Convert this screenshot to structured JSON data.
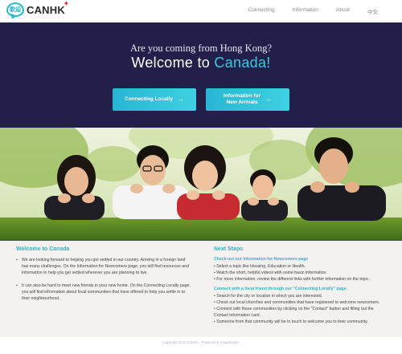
{
  "brand": {
    "logo_glyph": "歡迎",
    "name": "CANHK",
    "star": "✦"
  },
  "nav": {
    "items": [
      "Connecting",
      "Information",
      "About",
      "中文"
    ]
  },
  "hero": {
    "subtitle": "Are you coming from Hong Kong?",
    "title_prefix": "Welcome to ",
    "title_accent": "Canada!",
    "buttons": [
      {
        "label": "Connecting Locally",
        "arrow": "→"
      },
      {
        "label_line1": "Information for",
        "label_line2": "New Arrivals",
        "arrow": "→"
      }
    ]
  },
  "photo": {
    "icon": "family-photo"
  },
  "welcome": {
    "title": "Welcome to Canada",
    "paragraphs": [
      "We are looking forward to helping you get settled in our country.  Arriving in a foreign land has many challenges.  On the Information for Newcomers page, you will find resources and information to help you get settled wherever you are planning to live.",
      "It can also be hard to meet new friends in your new home. On the Connecting Locally page, you will find information about local communities that have offered to help you settle in to their neighbourhood."
    ]
  },
  "next_steps": {
    "title": "Next Steps",
    "groups": [
      {
        "heading": "Check out our Information for Newcomers page",
        "lines": [
          "• Select a topic like Housing, Education or Health.",
          "• Watch the short, helpful videos with some basic information.",
          "• For more information, review the different links with further information on the topic.."
        ]
      },
      {
        "heading": "Connect with a local friend through our \"Connecting Locally\" page.",
        "lines": [
          "• Search for the city or location in which you are interested.",
          "• Check out local churches and communities that have registered to welcome newcomers.",
          "• Connect with these communities by clicking on the \"Contact\" button and filling out the Contact information card.",
          "• Someone from that community will be in touch to welcome you to their community."
        ]
      }
    ]
  },
  "footer": {
    "text": "Copyright 2021 CANHK · Powered by Kingdomizer"
  },
  "colors": {
    "accent": "#2bb7cf",
    "hero_bg": "#221f4a",
    "content_bg": "#f5f1ef",
    "logo_star": "#e8323c"
  }
}
